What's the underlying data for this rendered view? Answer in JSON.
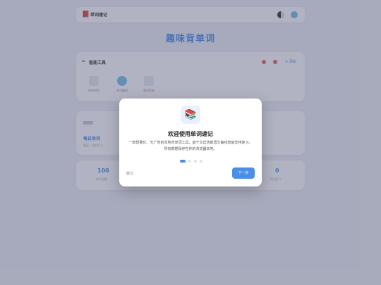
{
  "app": {
    "brand_name": "单词速记",
    "hero_title": "趣味背单词"
  },
  "tools": {
    "title": "智能工具",
    "link": "+ 添加",
    "items": [
      {
        "label": "单词测试"
      },
      {
        "label": "单词翻译"
      },
      {
        "label": "单词列表"
      }
    ]
  },
  "word": {
    "text": "每日单词",
    "sub": "暂无 · 点击学习"
  },
  "stats": [
    {
      "value": "100",
      "label": "单词总数"
    },
    {
      "value": "0",
      "label": "今日复习"
    }
  ],
  "modal": {
    "title": "欢迎使用单词速记",
    "description": "一款轻量化、无广告的本地背单词工具，基于艾宾浩斯遗忘曲线智能安排复习。所有数据保存在你的浏览器本地。",
    "skip_label": "跳过",
    "next_label": "下一步",
    "page_index": 1,
    "page_count": 4
  },
  "colors": {
    "accent": "#4b8ee8",
    "overlay": "#464b6e"
  }
}
